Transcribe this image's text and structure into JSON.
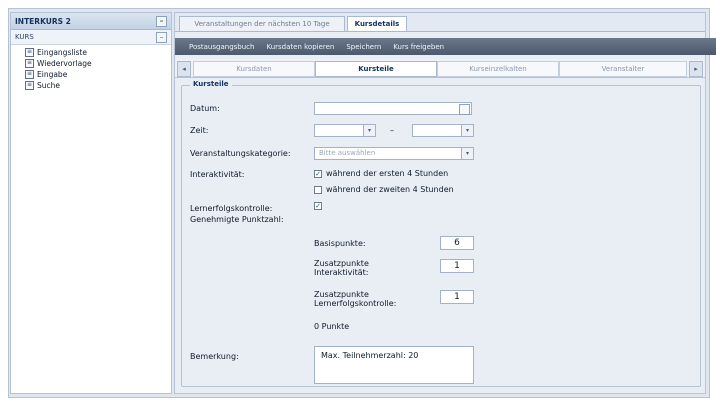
{
  "sidebar": {
    "header_title": "INTERKURS 2",
    "header_btn": "–",
    "sub_title": "KURS",
    "sub_btn": "–",
    "items": [
      {
        "label": "Eingangsliste"
      },
      {
        "label": "Wiedervorlage"
      },
      {
        "label": "Eingabe"
      },
      {
        "label": "Suche"
      }
    ]
  },
  "tabs": {
    "inactive": "Veranstaltungen der nächsten 10 Tage",
    "active": "Kursdetails"
  },
  "toolbar": {
    "items": [
      "Postausgangsbuch",
      "Kursdaten kopieren",
      "Speichern",
      "Kurs freigeben"
    ]
  },
  "subtabs": {
    "left_arrow": "◂",
    "right_arrow": "▸",
    "items": [
      "Kursdaten",
      "Kursteile",
      "Kurseinzelkalten",
      "Veranstalter"
    ]
  },
  "form": {
    "legend": "Kursteile",
    "datum_label": "Datum:",
    "zeit_label": "Zeit:",
    "zeit_separator": "–",
    "kategorie_label": "Veranstaltungskategorie:",
    "kategorie_placeholder": "Bitte auswählen",
    "interaktivitaet_label": "Interaktivität:",
    "opt1_label": "während der ersten 4 Stunden",
    "opt2_label": "während der zweiten 4 Stunden",
    "lernerfolg_label": "Lernerfolgskontrolle:",
    "punkte_label": "Genehmigte Punktzahl:",
    "basis_label": "Basispunkte:",
    "basis_value": "6",
    "zusatz_inter_label_1": "Zusatzpunkte",
    "zusatz_inter_label_2": "Interaktivität:",
    "zusatz_inter_value": "1",
    "zusatz_lern_label_1": "Zusatzpunkte",
    "zusatz_lern_label_2": "Lernerfolgskontrolle:",
    "zusatz_lern_value": "1",
    "total": "0 Punkte",
    "bemerkung_label": "Bemerkung:",
    "bemerkung_value": "Max. Teilnehmerzahl: 20",
    "check_mark": "✓",
    "dropdown_arrow": "▾"
  }
}
